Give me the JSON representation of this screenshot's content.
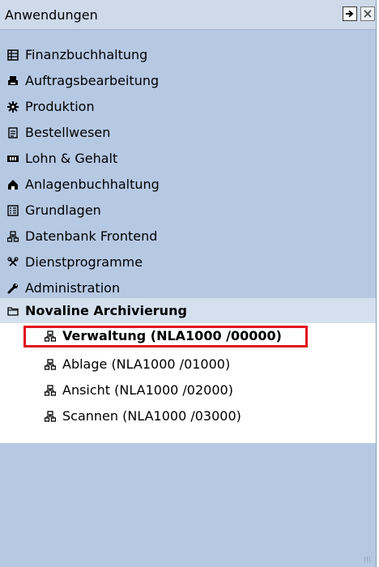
{
  "panel": {
    "title": "Anwendungen"
  },
  "menu": [
    {
      "label": "Finanzbuchhaltung",
      "icon": "ledger-icon"
    },
    {
      "label": "Auftragsbearbeitung",
      "icon": "printer-icon"
    },
    {
      "label": "Produktion",
      "icon": "gear-icon"
    },
    {
      "label": "Bestellwesen",
      "icon": "document-icon"
    },
    {
      "label": "Lohn & Gehalt",
      "icon": "money-icon"
    },
    {
      "label": "Anlagenbuchhaltung",
      "icon": "building-icon"
    },
    {
      "label": "Grundlagen",
      "icon": "form-icon"
    },
    {
      "label": "Datenbank Frontend",
      "icon": "network-icon"
    },
    {
      "label": "Dienstprogramme",
      "icon": "tools-icon"
    },
    {
      "label": "Administration",
      "icon": "wrench-icon"
    },
    {
      "label": "Novaline Archivierung",
      "icon": "folder-icon"
    }
  ],
  "submenu": [
    {
      "label": "Verwaltung (NLA1000 /00000)"
    },
    {
      "label": "Ablage (NLA1000 /01000)"
    },
    {
      "label": "Ansicht (NLA1000 /02000)"
    },
    {
      "label": "Scannen (NLA1000 /03000)"
    }
  ],
  "scroll_hint": "III"
}
